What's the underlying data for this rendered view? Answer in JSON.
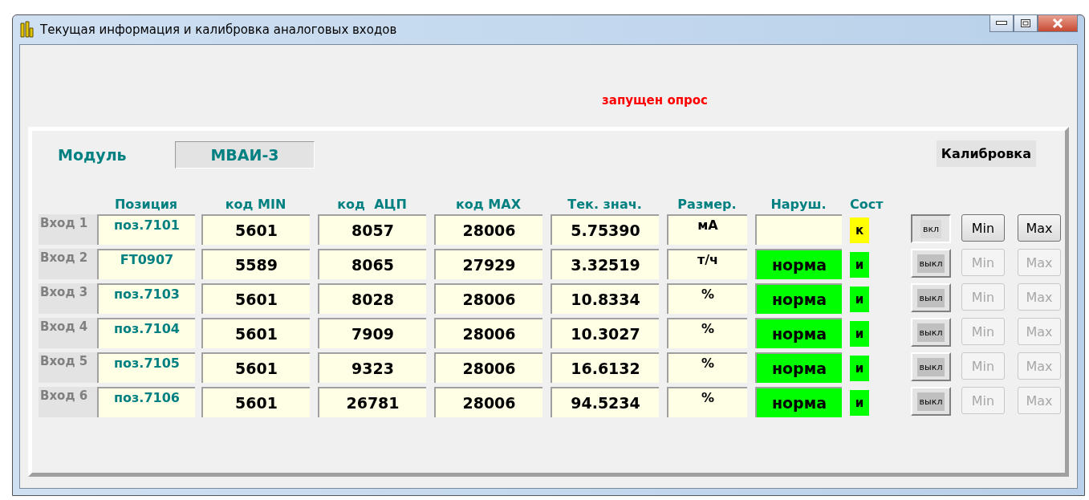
{
  "window": {
    "title": "Текущая информация и калибровка аналоговых входов"
  },
  "status_message": "запущен опрос",
  "module": {
    "label": "Модуль",
    "value": "МВАИ-3"
  },
  "calibration_label": "Калибровка",
  "columns": [
    "Позиция",
    "код MIN",
    "код  АЦП",
    "код MAX",
    "Тек. знач.",
    "Размер.",
    "Наруш.",
    "Сост"
  ],
  "rows": [
    {
      "input": "Вход 1",
      "position": "поз.7101",
      "code_min": "5601",
      "code_adc": "8057",
      "code_max": "28006",
      "value": "5.75390",
      "unit": "мА",
      "fault": {
        "color": "#ffffe6"
      },
      "state": {
        "text": "к",
        "color": "#ffff00"
      },
      "toggle": {
        "label": "вкл",
        "on": true
      },
      "min": {
        "label": "Min",
        "disabled": false
      },
      "max": {
        "label": "Max",
        "disabled": false
      }
    },
    {
      "input": "Вход 2",
      "position": "FT0907",
      "code_min": "5589",
      "code_adc": "8065",
      "code_max": "27929",
      "value": "3.32519",
      "unit": "т/ч",
      "fault": {
        "text": "норма",
        "color": "#00ff00"
      },
      "state": {
        "text": "и",
        "color": "#00ff00"
      },
      "toggle": {
        "label": "выкл",
        "on": false
      },
      "min": {
        "label": "Min",
        "disabled": true
      },
      "max": {
        "label": "Max",
        "disabled": true
      }
    },
    {
      "input": "Вход 3",
      "position": "поз.7103",
      "code_min": "5601",
      "code_adc": "8028",
      "code_max": "28006",
      "value": "10.8334",
      "unit": "%",
      "fault": {
        "text": "норма",
        "color": "#00ff00"
      },
      "state": {
        "text": "и",
        "color": "#00ff00"
      },
      "toggle": {
        "label": "выкл",
        "on": false
      },
      "min": {
        "label": "Min",
        "disabled": true
      },
      "max": {
        "label": "Max",
        "disabled": true
      }
    },
    {
      "input": "Вход 4",
      "position": "поз.7104",
      "code_min": "5601",
      "code_adc": "7909",
      "code_max": "28006",
      "value": "10.3027",
      "unit": "%",
      "fault": {
        "text": "норма",
        "color": "#00ff00"
      },
      "state": {
        "text": "и",
        "color": "#00ff00"
      },
      "toggle": {
        "label": "выкл",
        "on": false
      },
      "min": {
        "label": "Min",
        "disabled": true
      },
      "max": {
        "label": "Max",
        "disabled": true
      }
    },
    {
      "input": "Вход 5",
      "position": "поз.7105",
      "code_min": "5601",
      "code_adc": "9323",
      "code_max": "28006",
      "value": "16.6132",
      "unit": "%",
      "fault": {
        "text": "норма",
        "color": "#00ff00"
      },
      "state": {
        "text": "и",
        "color": "#00ff00"
      },
      "toggle": {
        "label": "выкл",
        "on": false
      },
      "min": {
        "label": "Min",
        "disabled": true
      },
      "max": {
        "label": "Max",
        "disabled": true
      }
    },
    {
      "input": "Вход 6",
      "position": "поз.7106",
      "code_min": "5601",
      "code_adc": "26781",
      "code_max": "28006",
      "value": "94.5234",
      "unit": "%",
      "fault": {
        "text": "норма",
        "color": "#00ff00"
      },
      "state": {
        "text": "и",
        "color": "#00ff00"
      },
      "toggle": {
        "label": "выкл",
        "on": false
      },
      "min": {
        "label": "Min",
        "disabled": true
      },
      "max": {
        "label": "Max",
        "disabled": true
      }
    }
  ]
}
